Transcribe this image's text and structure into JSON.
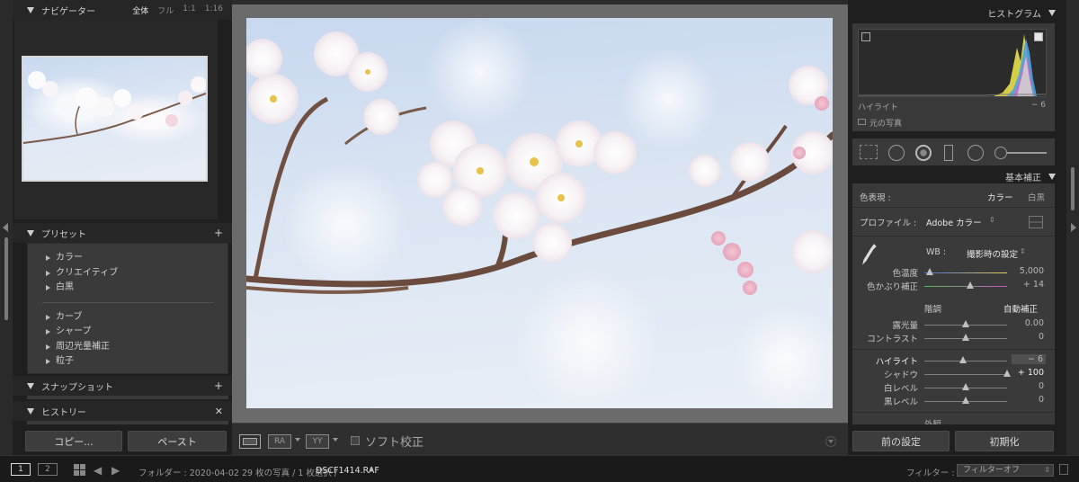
{
  "navigator": {
    "title": "ナビゲーター",
    "zoom_options": [
      "全体",
      "フル",
      "1:1",
      "1:16"
    ]
  },
  "presets": {
    "title": "プリセット",
    "add_icon": "plus-icon",
    "group_a": [
      "カラー",
      "クリエイティブ",
      "白黒"
    ],
    "group_b": [
      "カーブ",
      "シャープ",
      "周辺光量補正",
      "粒子"
    ]
  },
  "snapshots": {
    "title": "スナップショット"
  },
  "history": {
    "title": "ヒストリー"
  },
  "left_buttons": {
    "copy": "コピー...",
    "paste": "ペースト"
  },
  "toolbar": {
    "compare_ra": "RA",
    "compare_yy": "YY",
    "soft_proof": "ソフト校正"
  },
  "histogram": {
    "title": "ヒストグラム",
    "label": "ハイライト",
    "value": "− 6",
    "original_photo": "元の写真"
  },
  "basic": {
    "title": "基本補正",
    "treatment_label": "色表現 :",
    "treatment_color": "カラー",
    "treatment_bw": "白黒",
    "profile_label": "プロファイル :",
    "profile_value": "Adobe カラー",
    "wb_label": "WB :",
    "wb_value": "撮影時の設定",
    "tone_label": "階調",
    "auto_label": "自動補正",
    "presence_label": "外観",
    "sliders": [
      {
        "label": "色温度",
        "value": "5,000",
        "position": 0.07
      },
      {
        "label": "色かぶり補正",
        "value": "+ 14",
        "position": 0.55
      },
      {
        "label": "露光量",
        "value": "0.00",
        "position": 0.5
      },
      {
        "label": "コントラスト",
        "value": "0",
        "position": 0.5
      },
      {
        "label": "ハイライト",
        "value": "− 6",
        "position": 0.47
      },
      {
        "label": "シャドウ",
        "value": "+ 100",
        "position": 1.0
      },
      {
        "label": "白レベル",
        "value": "0",
        "position": 0.5
      },
      {
        "label": "黒レベル",
        "value": "0",
        "position": 0.5
      }
    ]
  },
  "right_buttons": {
    "previous": "前の設定",
    "reset": "初期化"
  },
  "filmstrip": {
    "view1": "1",
    "view2": "2",
    "path": "フォルダー : 2020-04-02   29 枚の写真 / 1 枚選択 /",
    "filename": "DSCF1414.RAF",
    "filter_label": "フィルター :",
    "filter_value": "フィルターオフ"
  },
  "colors": {
    "panel_bg": "#1f1f1f",
    "section_bg": "#3a3a3a",
    "canvas_bg": "#6b6b6b",
    "text": "#cfcfcf"
  }
}
